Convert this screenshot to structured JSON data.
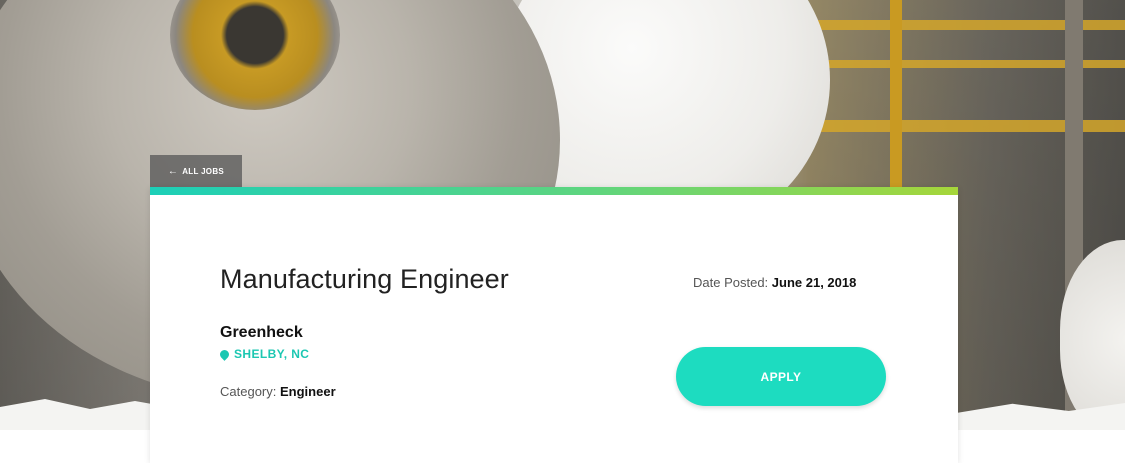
{
  "nav": {
    "back_label": "ALL JOBS"
  },
  "job": {
    "title": "Manufacturing Engineer",
    "company": "Greenheck",
    "location": "SHELBY, NC",
    "category_label": "Category:",
    "category_value": "Engineer",
    "date_label": "Date Posted:",
    "date_value": "June 21, 2018",
    "apply_label": "APPLY"
  },
  "colors": {
    "accent": "#1ddcc0",
    "accent_gradient_end": "#a6d63a",
    "location_text": "#1cc7b2"
  },
  "icons": {
    "back": "arrow-left-icon",
    "location": "location-pin-icon"
  }
}
